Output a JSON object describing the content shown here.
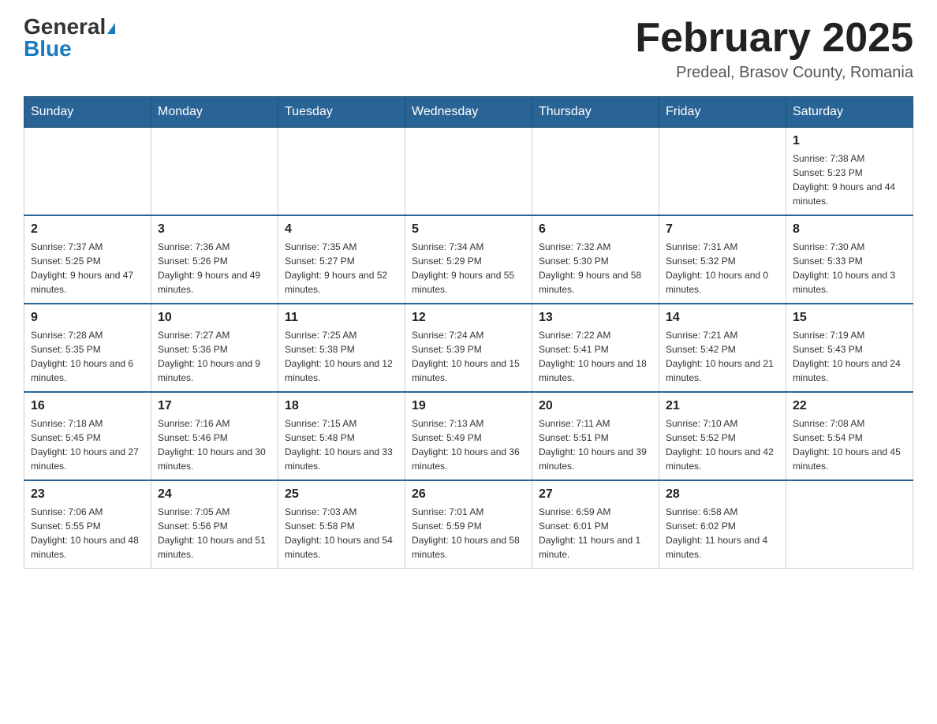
{
  "header": {
    "logo_general": "General",
    "logo_blue": "Blue",
    "month_title": "February 2025",
    "location": "Predeal, Brasov County, Romania"
  },
  "days_of_week": [
    "Sunday",
    "Monday",
    "Tuesday",
    "Wednesday",
    "Thursday",
    "Friday",
    "Saturday"
  ],
  "weeks": [
    [
      {
        "day": "",
        "info": ""
      },
      {
        "day": "",
        "info": ""
      },
      {
        "day": "",
        "info": ""
      },
      {
        "day": "",
        "info": ""
      },
      {
        "day": "",
        "info": ""
      },
      {
        "day": "",
        "info": ""
      },
      {
        "day": "1",
        "info": "Sunrise: 7:38 AM\nSunset: 5:23 PM\nDaylight: 9 hours and 44 minutes."
      }
    ],
    [
      {
        "day": "2",
        "info": "Sunrise: 7:37 AM\nSunset: 5:25 PM\nDaylight: 9 hours and 47 minutes."
      },
      {
        "day": "3",
        "info": "Sunrise: 7:36 AM\nSunset: 5:26 PM\nDaylight: 9 hours and 49 minutes."
      },
      {
        "day": "4",
        "info": "Sunrise: 7:35 AM\nSunset: 5:27 PM\nDaylight: 9 hours and 52 minutes."
      },
      {
        "day": "5",
        "info": "Sunrise: 7:34 AM\nSunset: 5:29 PM\nDaylight: 9 hours and 55 minutes."
      },
      {
        "day": "6",
        "info": "Sunrise: 7:32 AM\nSunset: 5:30 PM\nDaylight: 9 hours and 58 minutes."
      },
      {
        "day": "7",
        "info": "Sunrise: 7:31 AM\nSunset: 5:32 PM\nDaylight: 10 hours and 0 minutes."
      },
      {
        "day": "8",
        "info": "Sunrise: 7:30 AM\nSunset: 5:33 PM\nDaylight: 10 hours and 3 minutes."
      }
    ],
    [
      {
        "day": "9",
        "info": "Sunrise: 7:28 AM\nSunset: 5:35 PM\nDaylight: 10 hours and 6 minutes."
      },
      {
        "day": "10",
        "info": "Sunrise: 7:27 AM\nSunset: 5:36 PM\nDaylight: 10 hours and 9 minutes."
      },
      {
        "day": "11",
        "info": "Sunrise: 7:25 AM\nSunset: 5:38 PM\nDaylight: 10 hours and 12 minutes."
      },
      {
        "day": "12",
        "info": "Sunrise: 7:24 AM\nSunset: 5:39 PM\nDaylight: 10 hours and 15 minutes."
      },
      {
        "day": "13",
        "info": "Sunrise: 7:22 AM\nSunset: 5:41 PM\nDaylight: 10 hours and 18 minutes."
      },
      {
        "day": "14",
        "info": "Sunrise: 7:21 AM\nSunset: 5:42 PM\nDaylight: 10 hours and 21 minutes."
      },
      {
        "day": "15",
        "info": "Sunrise: 7:19 AM\nSunset: 5:43 PM\nDaylight: 10 hours and 24 minutes."
      }
    ],
    [
      {
        "day": "16",
        "info": "Sunrise: 7:18 AM\nSunset: 5:45 PM\nDaylight: 10 hours and 27 minutes."
      },
      {
        "day": "17",
        "info": "Sunrise: 7:16 AM\nSunset: 5:46 PM\nDaylight: 10 hours and 30 minutes."
      },
      {
        "day": "18",
        "info": "Sunrise: 7:15 AM\nSunset: 5:48 PM\nDaylight: 10 hours and 33 minutes."
      },
      {
        "day": "19",
        "info": "Sunrise: 7:13 AM\nSunset: 5:49 PM\nDaylight: 10 hours and 36 minutes."
      },
      {
        "day": "20",
        "info": "Sunrise: 7:11 AM\nSunset: 5:51 PM\nDaylight: 10 hours and 39 minutes."
      },
      {
        "day": "21",
        "info": "Sunrise: 7:10 AM\nSunset: 5:52 PM\nDaylight: 10 hours and 42 minutes."
      },
      {
        "day": "22",
        "info": "Sunrise: 7:08 AM\nSunset: 5:54 PM\nDaylight: 10 hours and 45 minutes."
      }
    ],
    [
      {
        "day": "23",
        "info": "Sunrise: 7:06 AM\nSunset: 5:55 PM\nDaylight: 10 hours and 48 minutes."
      },
      {
        "day": "24",
        "info": "Sunrise: 7:05 AM\nSunset: 5:56 PM\nDaylight: 10 hours and 51 minutes."
      },
      {
        "day": "25",
        "info": "Sunrise: 7:03 AM\nSunset: 5:58 PM\nDaylight: 10 hours and 54 minutes."
      },
      {
        "day": "26",
        "info": "Sunrise: 7:01 AM\nSunset: 5:59 PM\nDaylight: 10 hours and 58 minutes."
      },
      {
        "day": "27",
        "info": "Sunrise: 6:59 AM\nSunset: 6:01 PM\nDaylight: 11 hours and 1 minute."
      },
      {
        "day": "28",
        "info": "Sunrise: 6:58 AM\nSunset: 6:02 PM\nDaylight: 11 hours and 4 minutes."
      },
      {
        "day": "",
        "info": ""
      }
    ]
  ]
}
